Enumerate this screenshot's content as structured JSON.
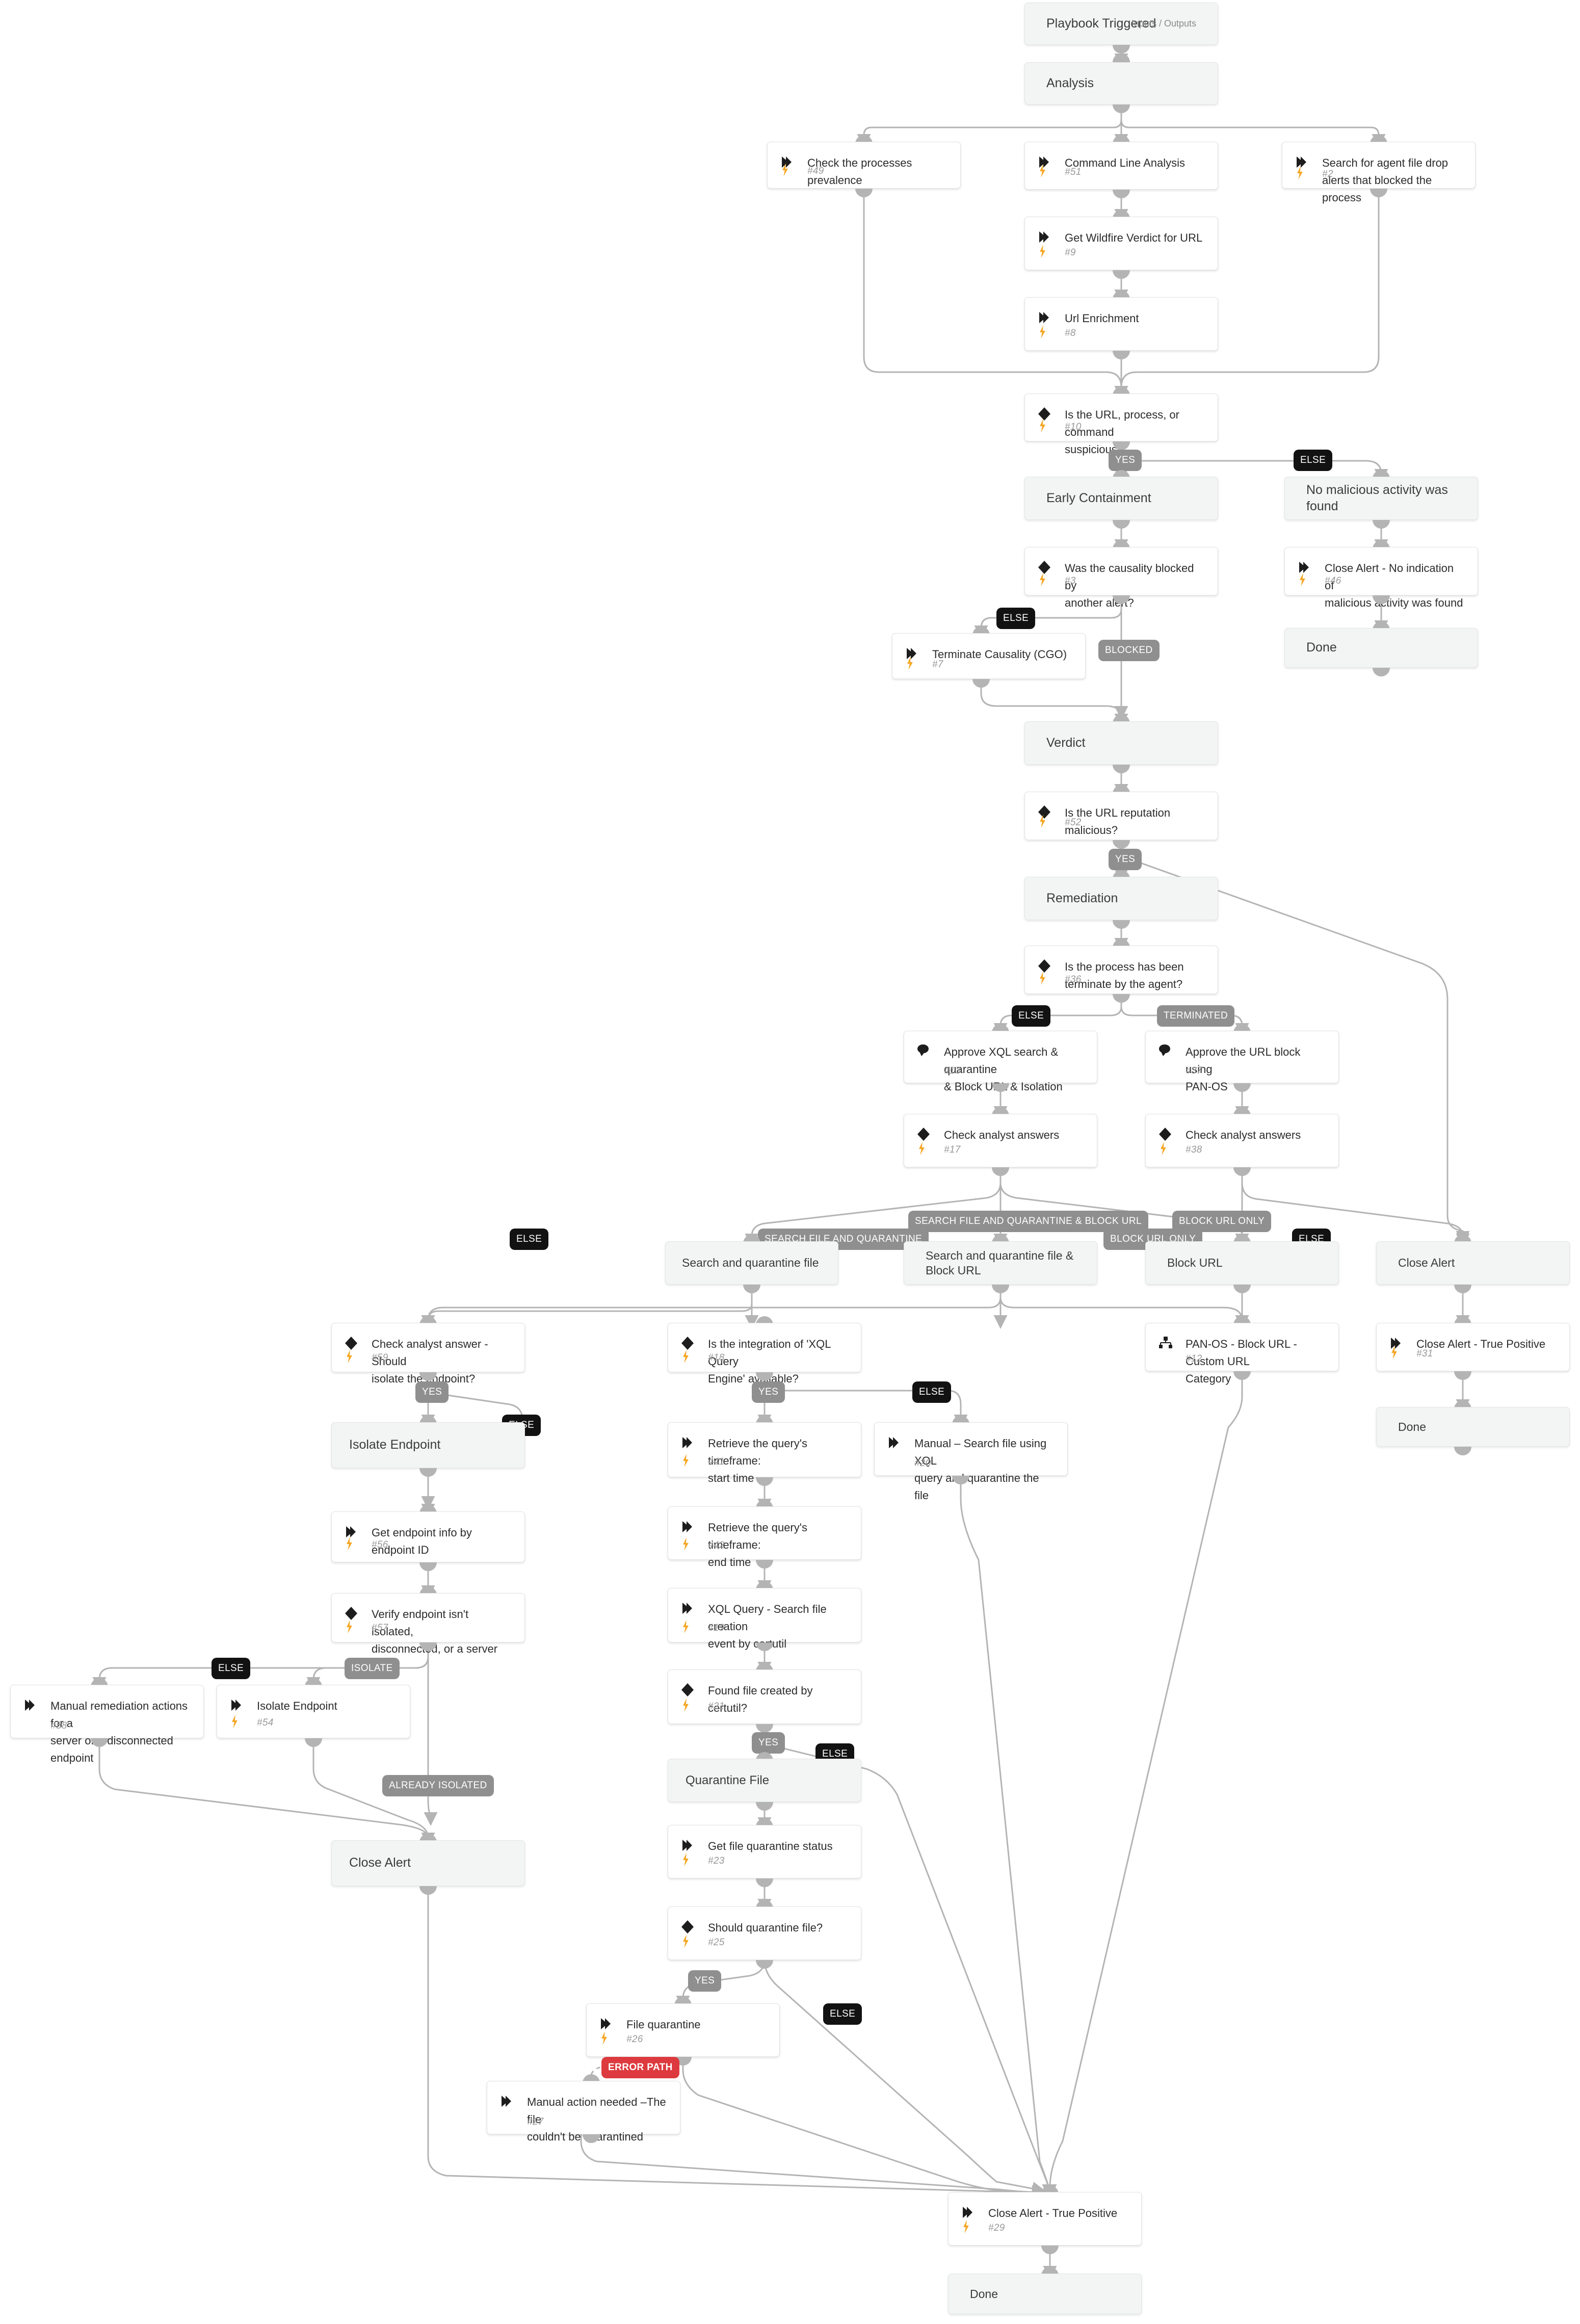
{
  "meta": {
    "inputs_outputs_label": "Inputs / Outputs"
  },
  "branch_labels": {
    "yes": "YES",
    "else": "ELSE",
    "blocked": "BLOCKED",
    "terminated": "TERMINATED",
    "isolate": "ISOLATE",
    "already_isolated": "ALREADY ISOLATED",
    "search_file_and_quarantine": "SEARCH FILE AND QUARANTINE",
    "search_file_and_quarantine_block_url": "SEARCH FILE AND QUARANTINE & BLOCK URL",
    "block_url_only": "BLOCK URL ONLY",
    "error_path": "ERROR PATH"
  },
  "colors": {
    "pill_grey": "#8f8f8f",
    "pill_black": "#121212",
    "pill_red": "#dd3a3f",
    "bolt_orange": "#f5a623",
    "section_bg": "#f3f5f4",
    "task_bg": "#ffffff",
    "edge_grey": "#b4b4b4"
  },
  "nodes": {
    "playbook_triggered": {
      "title": "Playbook Triggered",
      "kind": "section"
    },
    "analysis": {
      "title": "Analysis",
      "kind": "section"
    },
    "check_processes_prevalence": {
      "title": "Check the processes prevalence",
      "id": "#49",
      "icon": "command-icon",
      "bolt": true
    },
    "command_line_analysis": {
      "title": "Command Line Analysis",
      "id": "#51",
      "icon": "command-icon",
      "bolt": true
    },
    "search_agent_file_drop": {
      "title": "Search for agent file drop\nalerts that blocked the process",
      "id": "#2",
      "icon": "command-icon",
      "bolt": true
    },
    "get_wildfire_verdict": {
      "title": "Get Wildfire Verdict for URL",
      "id": "#9",
      "icon": "command-icon",
      "bolt": true
    },
    "url_enrichment": {
      "title": "Url Enrichment",
      "id": "#8",
      "icon": "command-icon",
      "bolt": true
    },
    "is_url_suspicious": {
      "title": "Is the URL, process, or command\nsuspicious?",
      "id": "#10",
      "icon": "condition-icon",
      "bolt": true
    },
    "early_containment": {
      "title": "Early Containment",
      "kind": "section"
    },
    "no_malicious_activity": {
      "title": "No malicious activity was found",
      "kind": "section"
    },
    "was_causality_blocked": {
      "title": "Was the causality blocked by\nanother alert?",
      "id": "#3",
      "icon": "condition-icon",
      "bolt": true
    },
    "close_alert_no_indication": {
      "title": "Close Alert - No indication of\nmalicious activity was found",
      "id": "#46",
      "icon": "command-icon",
      "bolt": true
    },
    "done_a": {
      "title": "Done",
      "kind": "section"
    },
    "terminate_causality": {
      "title": "Terminate Causality (CGO)",
      "id": "#7",
      "icon": "command-icon",
      "bolt": true
    },
    "verdict": {
      "title": "Verdict",
      "kind": "section"
    },
    "is_url_reputation_malicious": {
      "title": "Is the URL reputation malicious?",
      "id": "#52",
      "icon": "condition-icon",
      "bolt": true
    },
    "remediation": {
      "title": "Remediation",
      "kind": "section"
    },
    "is_process_terminated": {
      "title": "Is the process has been\nterminate by the agent?",
      "id": "#36",
      "icon": "condition-icon",
      "bolt": true
    },
    "approve_xql_search": {
      "title": "Approve XQL search & quarantine\n& Block URL & Isolation",
      "id": "#13",
      "icon": "approval-icon",
      "bolt": false
    },
    "approve_url_block": {
      "title": "Approve the URL block using\nPAN-OS",
      "id": "#37",
      "icon": "approval-icon",
      "bolt": false
    },
    "check_analyst_answers_17": {
      "title": "Check analyst answers",
      "id": "#17",
      "icon": "condition-icon",
      "bolt": true
    },
    "check_analyst_answers_38": {
      "title": "Check analyst answers",
      "id": "#38",
      "icon": "condition-icon",
      "bolt": true
    },
    "search_and_quarantine_file": {
      "title": "Search and quarantine file",
      "kind": "section"
    },
    "search_quarantine_block_url": {
      "title": "Search and quarantine file &\nBlock URL",
      "kind": "section"
    },
    "block_url": {
      "title": "Block URL",
      "kind": "section"
    },
    "close_alert_section": {
      "title": "Close Alert",
      "kind": "section"
    },
    "check_analyst_isolate": {
      "title": "Check analyst answer - Should\nisolate the endpoint?",
      "id": "#59",
      "icon": "condition-icon",
      "bolt": true
    },
    "is_xql_available": {
      "title": "Is the integration of 'XQL Query\nEngine' available?",
      "id": "#18",
      "icon": "condition-icon",
      "bolt": true
    },
    "panos_block_url": {
      "title": "PAN-OS - Block URL - Custom URL\nCategory",
      "id": "#12",
      "icon": "sub-playbook-icon",
      "bolt": false
    },
    "close_alert_true_positive_31": {
      "title": "Close Alert - True Positive",
      "id": "#31",
      "icon": "command-icon",
      "bolt": true
    },
    "isolate_endpoint_section": {
      "title": "Isolate Endpoint",
      "kind": "section"
    },
    "retrieve_start_time": {
      "title": "Retrieve the query's timeframe:\nstart time",
      "id": "#41",
      "icon": "command-icon",
      "bolt": true
    },
    "manual_search_xql": {
      "title": "Manual – Search file using XQL\nquery and quarantine the file",
      "id": "#20",
      "icon": "command-icon",
      "bolt": false
    },
    "done_b": {
      "title": "Done",
      "kind": "section"
    },
    "get_endpoint_info": {
      "title": "Get endpoint info by endpoint ID",
      "id": "#56",
      "icon": "command-icon",
      "bolt": true
    },
    "retrieve_end_time": {
      "title": "Retrieve the query's timeframe:\nend time",
      "id": "#42",
      "icon": "command-icon",
      "bolt": true
    },
    "xql_query_search": {
      "title": "XQL Query - Search file creation\nevent by certutil",
      "id": "#19",
      "icon": "command-icon",
      "bolt": true
    },
    "verify_endpoint": {
      "title": "Verify endpoint isn't isolated,\ndisconnected, or a server",
      "id": "#57",
      "icon": "condition-icon",
      "bolt": true
    },
    "found_file_certutil": {
      "title": "Found file created by certutil?",
      "id": "#21",
      "icon": "condition-icon",
      "bolt": true
    },
    "manual_remediation": {
      "title": "Manual remediation actions for a\nserver or a disconnected endpoint",
      "id": "#58",
      "icon": "command-icon",
      "bolt": false
    },
    "isolate_endpoint_task": {
      "title": "Isolate Endpoint",
      "id": "#54",
      "icon": "command-icon",
      "bolt": true
    },
    "quarantine_file_section": {
      "title": "Quarantine File",
      "kind": "section"
    },
    "close_alert_section_2": {
      "title": "Close Alert",
      "kind": "section"
    },
    "get_file_quarantine_status": {
      "title": "Get file quarantine status",
      "id": "#23",
      "icon": "command-icon",
      "bolt": true
    },
    "should_quarantine_file": {
      "title": "Should quarantine file?",
      "id": "#25",
      "icon": "condition-icon",
      "bolt": true
    },
    "file_quarantine": {
      "title": "File quarantine",
      "id": "#26",
      "icon": "command-icon",
      "bolt": true
    },
    "manual_action_needed": {
      "title": "Manual action needed –The file\ncouldn't be quarantined",
      "id": "#27",
      "icon": "command-icon",
      "bolt": false
    },
    "close_alert_true_positive_29": {
      "title": "Close Alert - True Positive",
      "id": "#29",
      "icon": "command-icon",
      "bolt": true
    },
    "done_c": {
      "title": "Done",
      "kind": "section"
    }
  }
}
